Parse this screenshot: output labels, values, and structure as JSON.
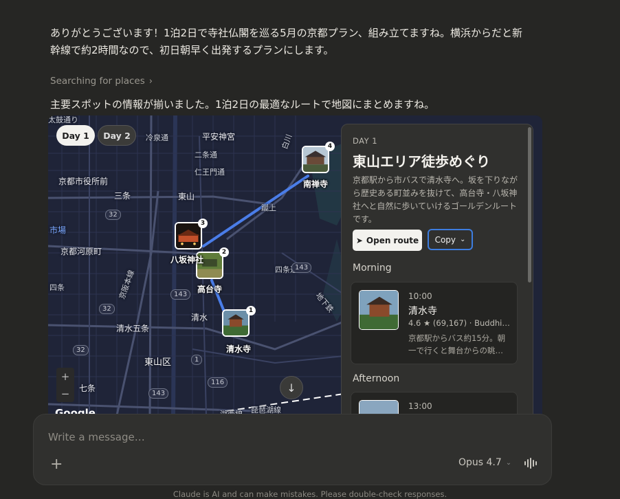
{
  "message": {
    "intro": "ありがとうございます！1泊2日で寺社仏閣を巡る5月の京都プラン、組み立てますね。横浜からだと新幹線で約2時間なので、初日朝早く出発するプランにします。",
    "searching": "Searching for places",
    "summary": "主要スポットの情報が揃いました。1泊2日の最適なルートで地図にまとめますね。"
  },
  "map": {
    "tabs": [
      "Day 1",
      "Day 2"
    ],
    "active_tab": "Day 1",
    "labels": {
      "top_left": "太鼓通り",
      "heian": "平安神宮",
      "reisen": "冷泉通",
      "nijo": "二条通",
      "niomon": "仁王門通",
      "city_hall": "京都市役所前",
      "sanjo": "三条",
      "higashiyama": "東山",
      "keage": "蹴上",
      "shirakawa": "白川",
      "market": "市場",
      "kawaramachi": "京都河原町",
      "shijo": "四条通",
      "shijo_left": "四条",
      "kyoto_honsen": "京阪本線",
      "shimizu": "清水",
      "gojo": "清水五条",
      "higashiyama_ward": "東山区",
      "shichijo": "七条",
      "subway": "地下鉄",
      "biwako": "琵琶湖線",
      "tokaido": "湖西線",
      "google": "Google"
    },
    "route_badges": [
      "32",
      "32",
      "32",
      "143",
      "143",
      "143",
      "116",
      "1",
      "1",
      "32"
    ],
    "pins": [
      {
        "num": "1",
        "label": "清水寺"
      },
      {
        "num": "2",
        "label": "高台寺"
      },
      {
        "num": "3",
        "label": "八坂神社"
      },
      {
        "num": "4",
        "label": "南禅寺"
      }
    ],
    "zoom_in": "+",
    "zoom_out": "−",
    "scroll_down": "↓"
  },
  "panel": {
    "day": "DAY 1",
    "title": "東山エリア徒歩めぐり",
    "description": "京都駅から市バスで清水寺へ。坂を下りながら歴史ある町並みを抜けて、高台寺・八坂神社へと自然に歩いていけるゴールデンルートです。",
    "open_route": "Open route",
    "copy": "Copy",
    "sections": {
      "morning": "Morning",
      "afternoon": "Afternoon"
    },
    "cards": [
      {
        "time": "10:00",
        "name": "清水寺",
        "rating": "4.6",
        "reviews": "(69,167)",
        "category": "Buddhi…",
        "desc": "京都駅からバス約15分。朝一で行くと舞台からの眺…"
      },
      {
        "time": "13:00"
      }
    ]
  },
  "composer": {
    "placeholder": "Write a message…",
    "model": "Opus 4.7"
  },
  "footer": "Claude is AI and can make mistakes. Please double-check responses.",
  "colors": {
    "background": "#262624",
    "map_bg": "#1d2236",
    "route": "#4a7de8",
    "accent_focus": "#3d7de0"
  }
}
